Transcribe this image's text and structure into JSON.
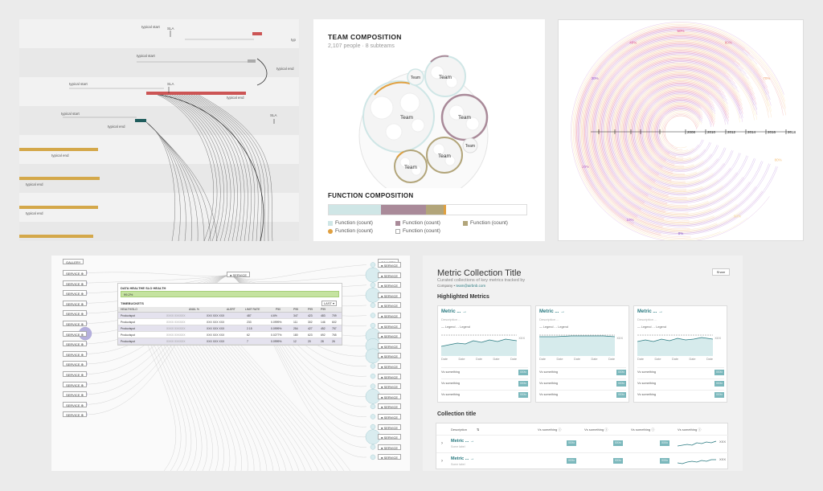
{
  "timeline": {
    "typical_start": "typical start",
    "typical_end": "typical end",
    "sla": "SLA",
    "typ_clipped": "typ"
  },
  "team": {
    "title": "TEAM COMPOSITION",
    "subtitle": "2,107 people · 8 subteams",
    "team_label": "Team",
    "function_title": "FUNCTION COMPOSITION",
    "function_legend": "Function (count)",
    "colors": {
      "teal": "#cfe6e6",
      "mauve": "#a98a99",
      "olive": "#b2a57a",
      "orange": "#e0a040"
    }
  },
  "radial": {
    "years": [
      "2008",
      "2010",
      "2012",
      "2014",
      "2016",
      "2018"
    ],
    "percents": [
      "50%",
      "40%",
      "60%",
      "30%",
      "70%",
      "20%",
      "80%",
      "10%",
      "90%",
      "0%"
    ]
  },
  "dependency": {
    "service": "SERVICE",
    "header_left": "GALLERY",
    "header_right": "GALLERY",
    "card_title": "DATA HEALTHE SLO HEALTH",
    "card_status": "99.2%",
    "card_section": "TIMEBUCKETS",
    "card_filter": "LAST",
    "columns": [
      "HEALTH/SLO",
      "AVAIL %",
      "ALERT",
      "LIMIT RATE",
      "P50",
      "P95",
      "P99",
      "P99"
    ],
    "rows": [
      [
        "Productspot",
        "XXXX XXXXXX",
        "XXX XXX XXX",
        "487",
        "4.6%",
        "347",
        "423",
        "483",
        "709"
      ],
      [
        "Productspot",
        "XXXX XXXXXX",
        "XXX XXX XXX",
        "233",
        "0.0999%",
        "111",
        "302",
        "146",
        "602"
      ],
      [
        "Productspot",
        "XXXX XXXXXX",
        "XXX XXX XXX",
        "2.15",
        "0.0999%",
        "254",
        "427",
        "452",
        "757"
      ],
      [
        "Productspot",
        "XXXX XXXXXX",
        "XXX XXX XXX",
        "62",
        "0.0277%",
        "180",
        "623",
        "692",
        "765"
      ],
      [
        "Productspot",
        "XXXX XXXXXX",
        "XXX XXX XXX",
        "7",
        "0.0999%",
        "12",
        "20",
        "28",
        "26"
      ]
    ]
  },
  "metrics": {
    "title": "Metric Collection Title",
    "description": "Curated collections of key metrics tracked by",
    "company": "Company",
    "team": "team@airbnb.com",
    "share": "Share",
    "highlighted_heading": "Highlighted Metrics",
    "card_title": "Metric ... →",
    "card_description": "Description ...",
    "legend": "— Legend  - - Legend",
    "xxx": "XXX",
    "date": "Date",
    "vs": "Vs something",
    "badge": "XXXx",
    "collection_heading": "Collection title",
    "table_description": "Description",
    "table_vs": "Vs something ⓘ",
    "row_title": "Metric ... →",
    "row_sub": "Some label"
  }
}
